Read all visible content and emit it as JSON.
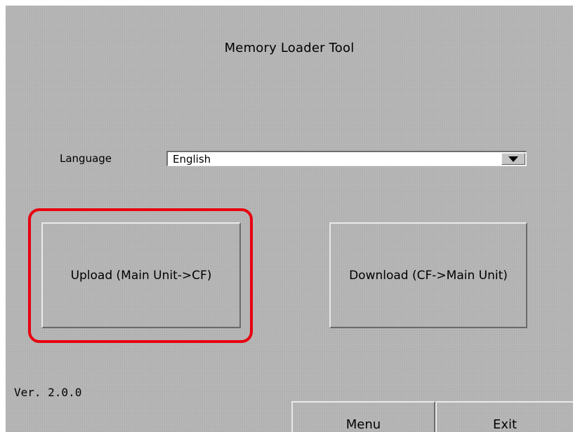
{
  "window": {
    "title": "Memory Loader Tool"
  },
  "language": {
    "label": "Language",
    "selected": "English"
  },
  "actions": {
    "upload_label": "Upload (Main Unit->CF)",
    "download_label": "Download (CF->Main Unit)"
  },
  "footer": {
    "version": "Ver. 2.0.0",
    "menu_label": "Menu",
    "exit_label": "Exit"
  },
  "colors": {
    "background": "#b5b5b5",
    "highlight": "#e8000f"
  },
  "icons": {
    "dropdown": "chevron-down-icon"
  }
}
